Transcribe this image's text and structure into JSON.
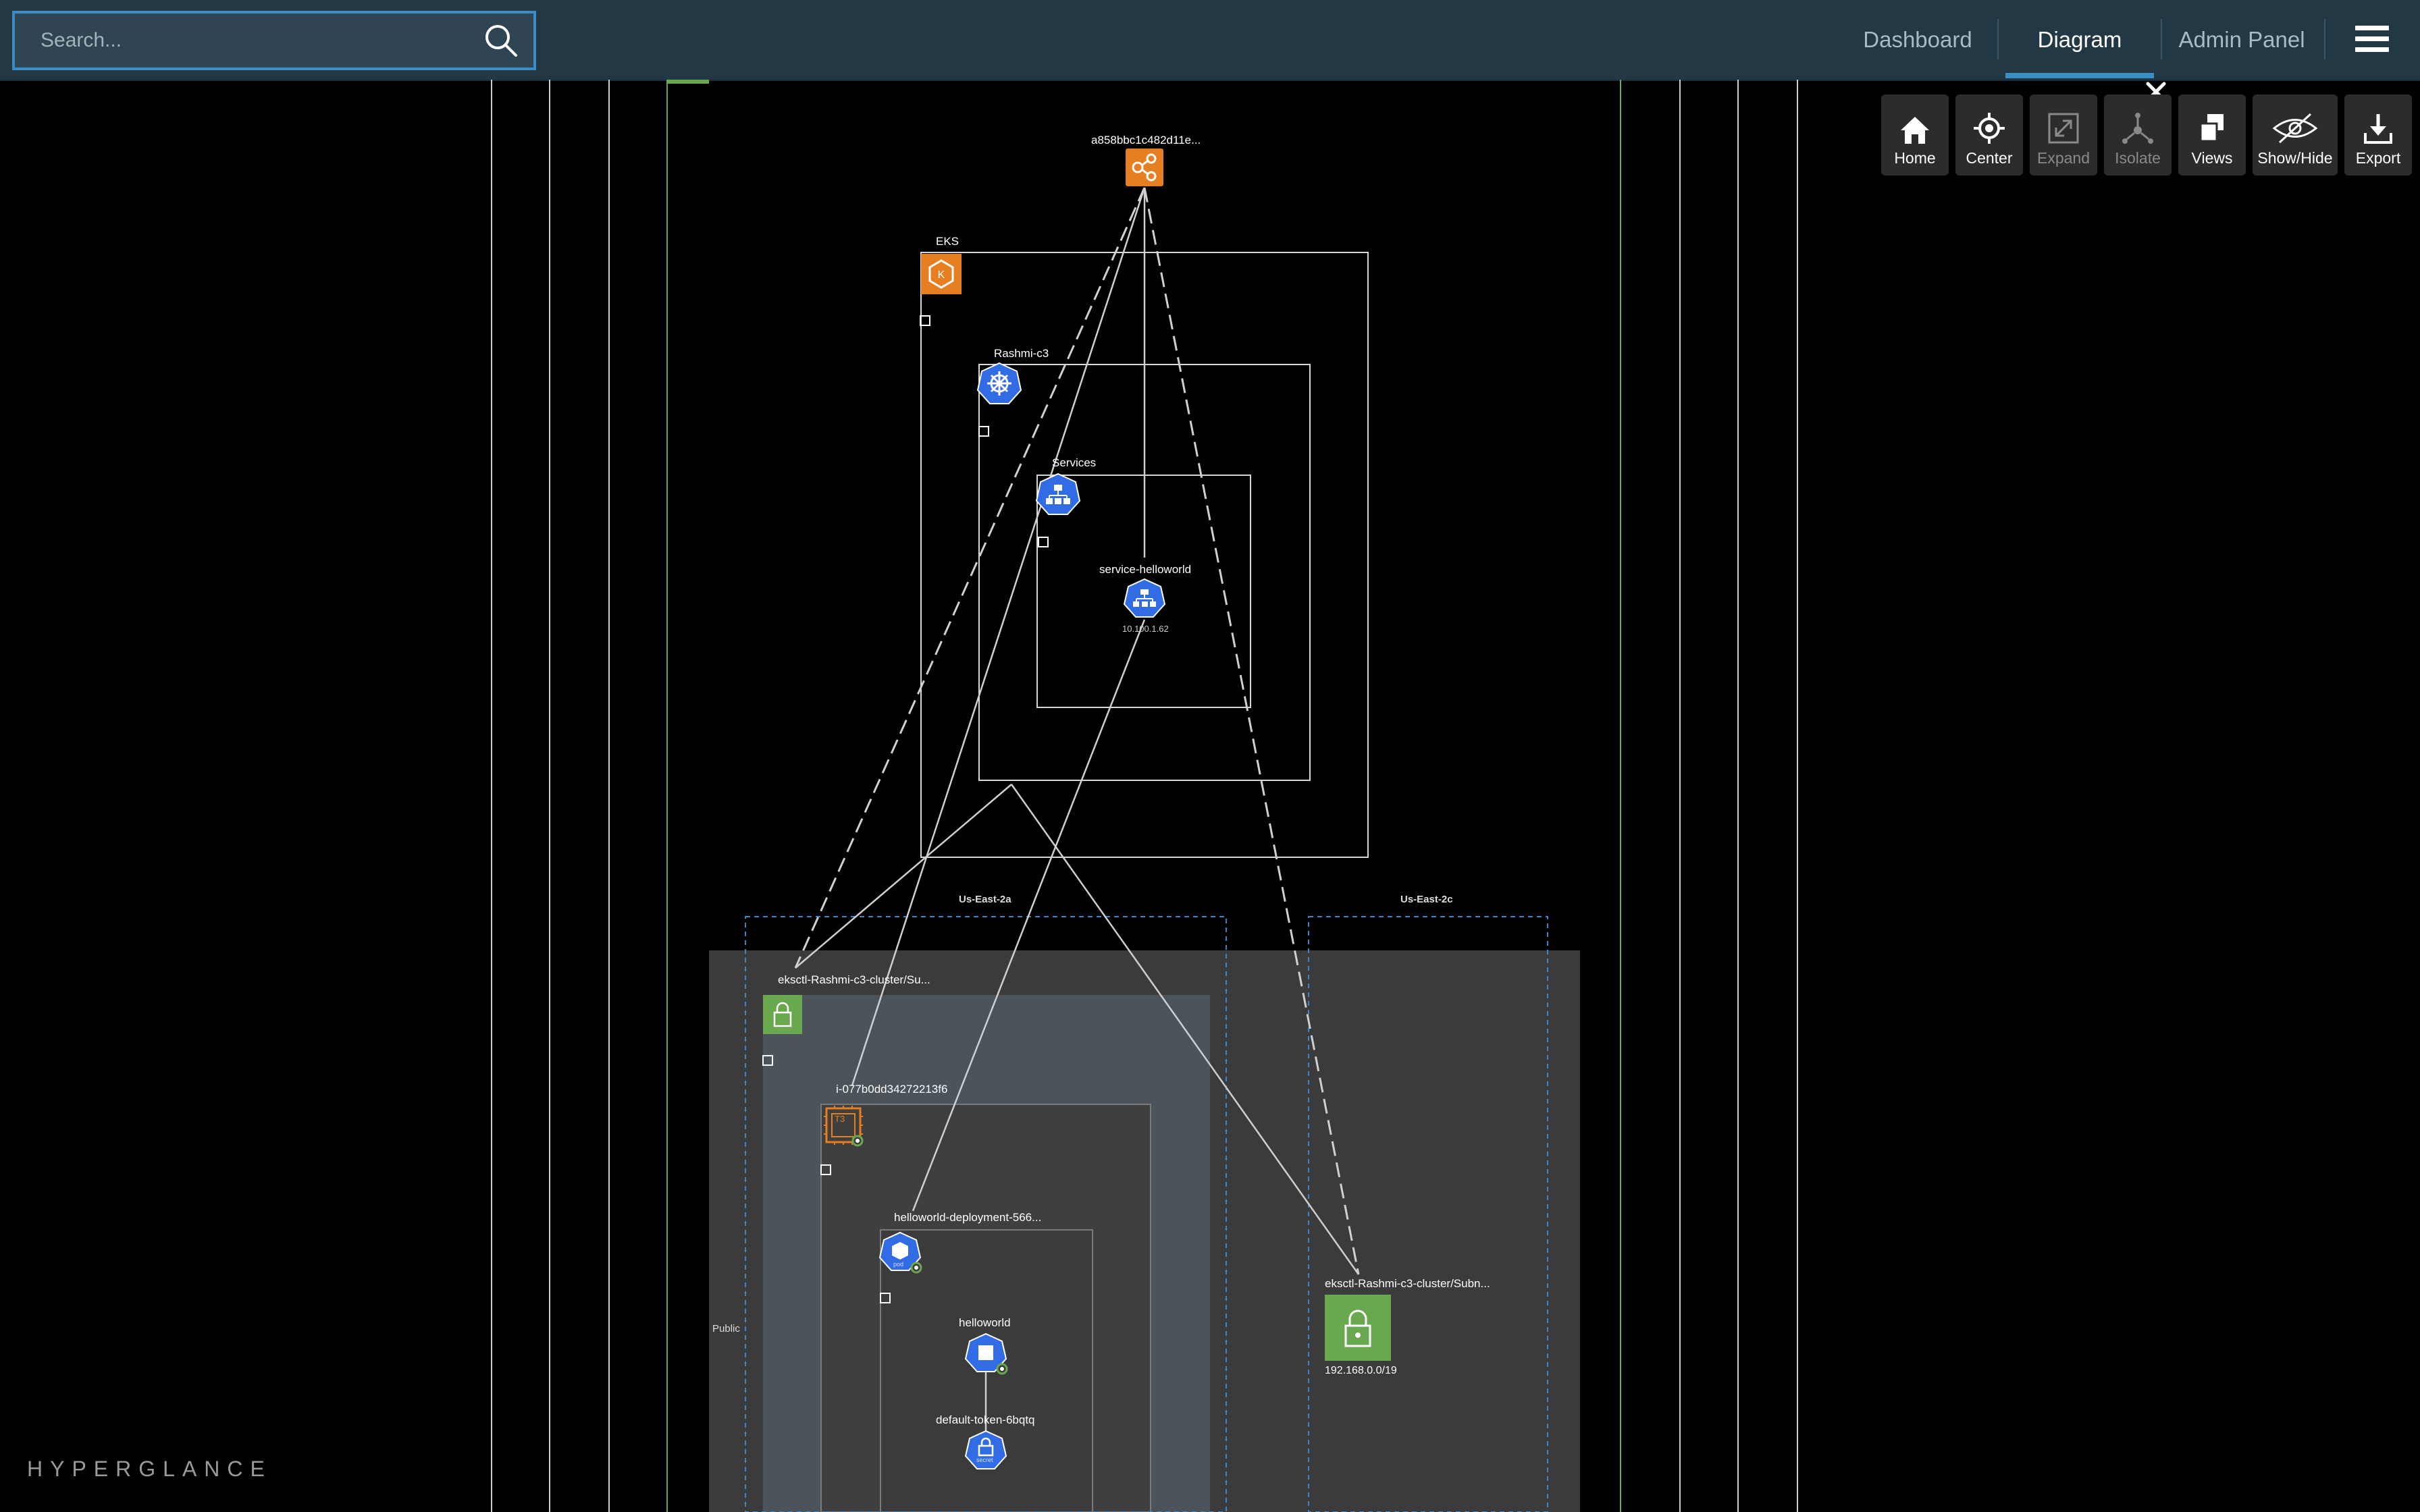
{
  "search": {
    "placeholder": "Search..."
  },
  "nav": {
    "items": [
      {
        "label": "Dashboard"
      },
      {
        "label": "Diagram"
      },
      {
        "label": "Admin Panel"
      }
    ],
    "active": "Diagram"
  },
  "toolbar": {
    "home": "Home",
    "center": "Center",
    "expand": "Expand",
    "isolate": "Isolate",
    "views": "Views",
    "show_hide": "Show/Hide",
    "export": "Export"
  },
  "diagram": {
    "load_balancer": "a858bbc1c482d11e...",
    "eks": "EKS",
    "cluster": "Rashmi-c3",
    "services": "Services",
    "service": {
      "name": "service-helloworld",
      "ip": "10.100.1.62"
    },
    "zone_a": "Us-East-2a",
    "zone_c": "Us-East-2c",
    "subnet_a": "eksctl-Rashmi-c3-cluster/Su...",
    "subnet_c": {
      "name": "eksctl-Rashmi-c3-cluster/Subn...",
      "cidr": "192.168.0.0/19"
    },
    "instance": {
      "name": "i-077b0dd34272213f6",
      "badge": "T3"
    },
    "deployment": "helloworld-deployment-566...",
    "pod_badge": "pod",
    "container": "helloworld",
    "secret": {
      "name": "default-token-6bqtq",
      "badge": "secret"
    },
    "public_label": "Public"
  },
  "branding": {
    "watermark": "HYPERGLANCE"
  },
  "colors": {
    "topbar": "#223845",
    "accent": "#3a8fc2",
    "aws_orange": "#e67e22",
    "k8s_blue": "#326ce5",
    "subnet_green": "#6aa84f"
  }
}
